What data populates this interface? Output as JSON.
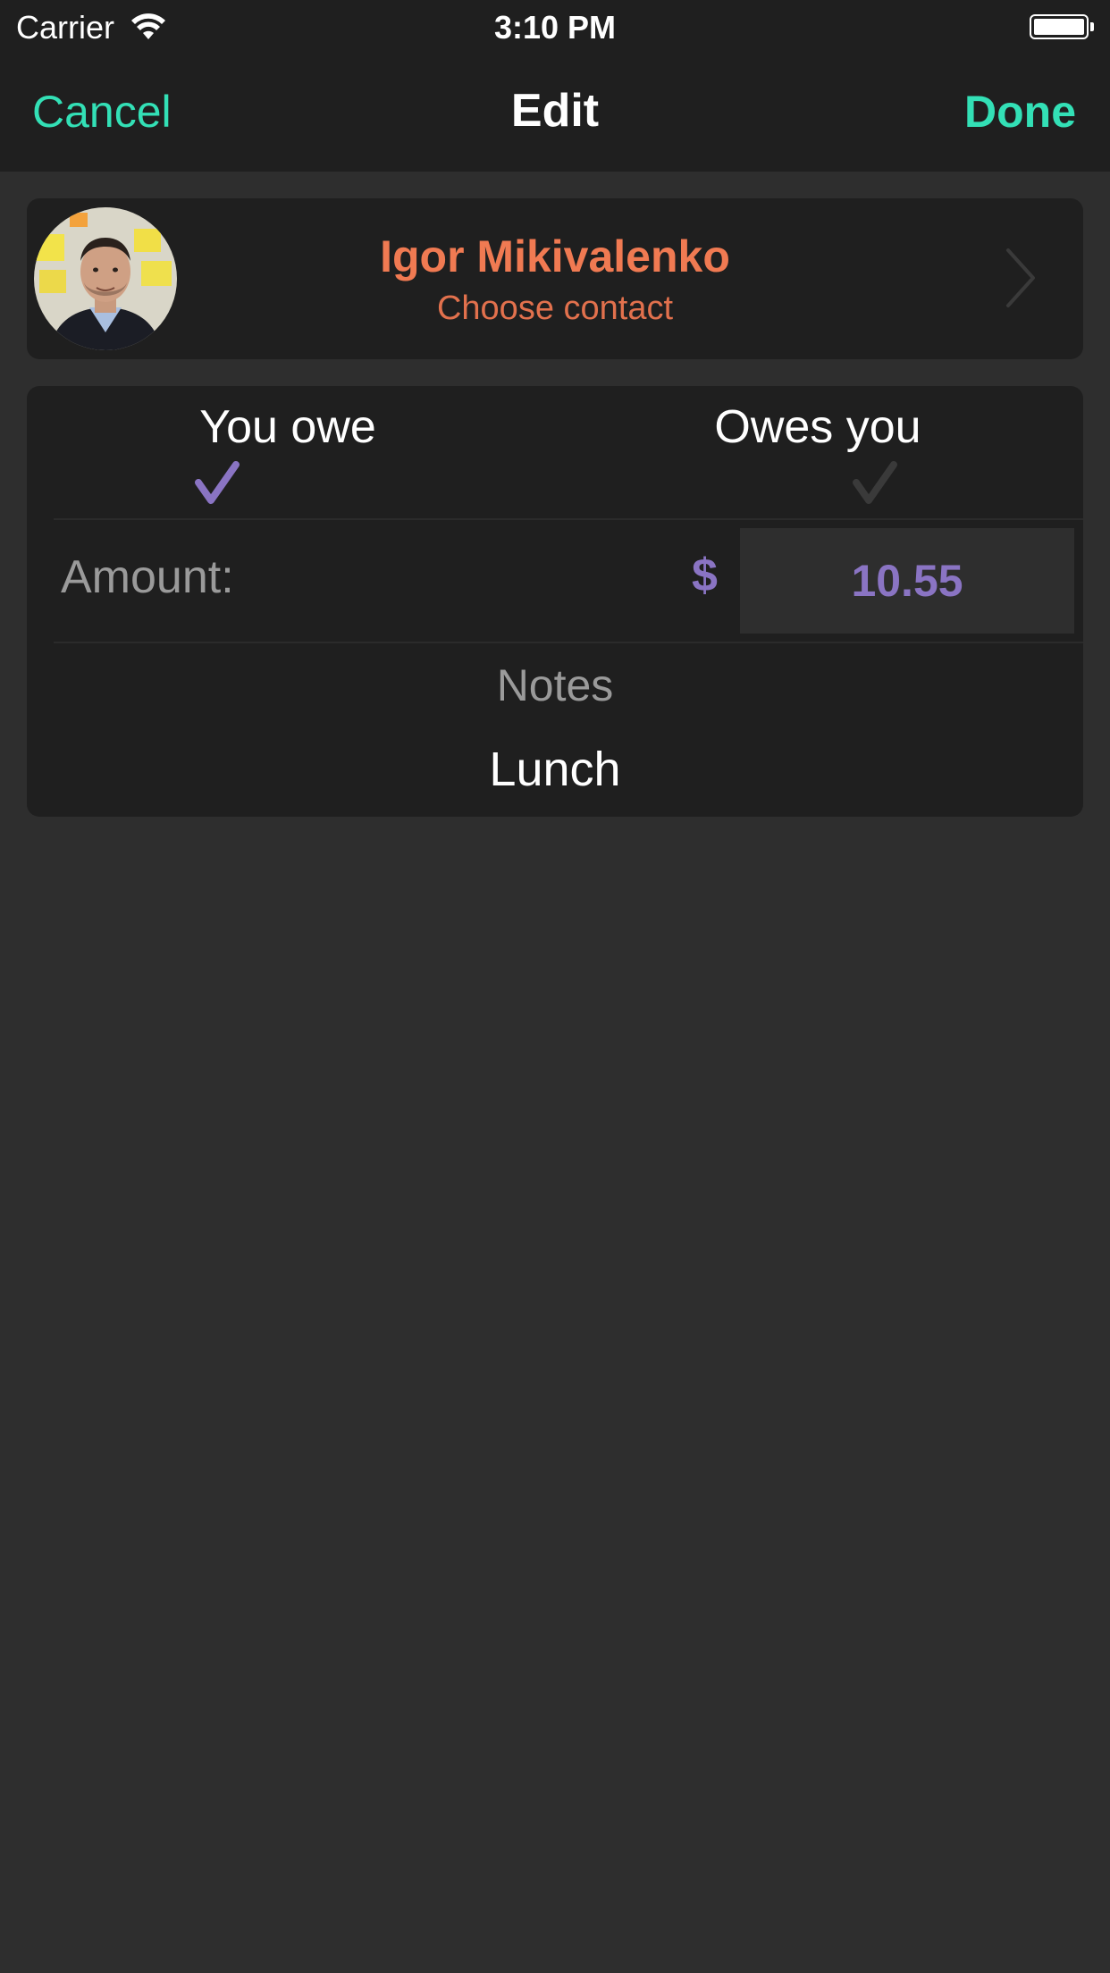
{
  "status_bar": {
    "carrier": "Carrier",
    "time": "3:10 PM",
    "wifi_icon": "wifi-icon",
    "battery_icon": "battery-icon"
  },
  "nav": {
    "cancel_label": "Cancel",
    "title": "Edit",
    "done_label": "Done"
  },
  "contact": {
    "name": "Igor Mikivalenko",
    "subtitle": "Choose contact",
    "avatar_icon": "contact-avatar",
    "chevron_icon": "chevron-right-icon"
  },
  "debt": {
    "you_owe_label": "You owe",
    "owes_you_label": "Owes you",
    "selected": "you_owe",
    "amount_label": "Amount:",
    "currency_symbol": "$",
    "amount_value": "10.55",
    "notes_label": "Notes",
    "notes_value": "Lunch"
  },
  "colors": {
    "accent_teal": "#33e0b6",
    "contact_orange": "#f07a52",
    "amount_purple": "#8a74c3",
    "background": "#2e2e2e",
    "card": "#1f1f1f"
  }
}
